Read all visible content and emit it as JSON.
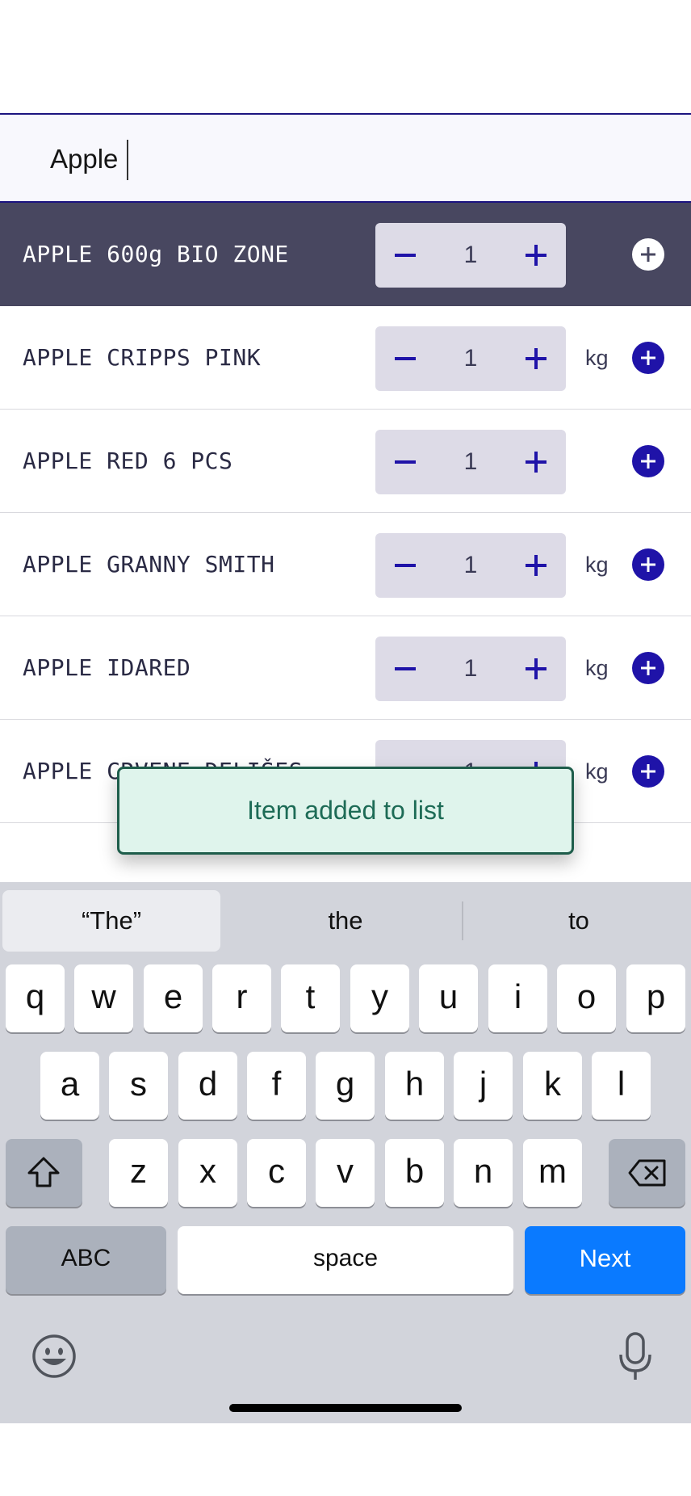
{
  "search": {
    "value": "Apple"
  },
  "items": [
    {
      "name": "APPLE 600g BIO ZONE",
      "qty": "1",
      "unit": "",
      "selected": true
    },
    {
      "name": "APPLE CRIPPS PINK",
      "qty": "1",
      "unit": "kg",
      "selected": false
    },
    {
      "name": "APPLE RED 6 PCS",
      "qty": "1",
      "unit": "",
      "selected": false
    },
    {
      "name": "APPLE GRANNY SMITH",
      "qty": "1",
      "unit": "kg",
      "selected": false
    },
    {
      "name": "APPLE IDARED",
      "qty": "1",
      "unit": "kg",
      "selected": false
    },
    {
      "name": "APPLE CRVENE DELIŠES",
      "qty": "1",
      "unit": "kg",
      "selected": false
    }
  ],
  "toast": {
    "message": "Item added to list"
  },
  "keyboard": {
    "suggestions": [
      "“The”",
      "the",
      "to"
    ],
    "row1": [
      "q",
      "w",
      "e",
      "r",
      "t",
      "y",
      "u",
      "i",
      "o",
      "p"
    ],
    "row2": [
      "a",
      "s",
      "d",
      "f",
      "g",
      "h",
      "j",
      "k",
      "l"
    ],
    "row3": [
      "z",
      "x",
      "c",
      "v",
      "b",
      "n",
      "m"
    ],
    "abc_label": "ABC",
    "space_label": "space",
    "next_label": "Next"
  },
  "colors": {
    "accent": "#1f13a8",
    "selected_row": "#484760",
    "toast_bg": "#dff4ec",
    "toast_text": "#1d6b56",
    "next_key": "#0a7aff"
  }
}
